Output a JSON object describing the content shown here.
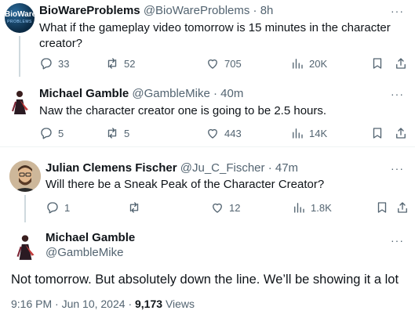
{
  "tweets": [
    {
      "name": "BioWareProblems",
      "handle": "@BioWareProblems",
      "sep": "·",
      "time": "8h",
      "text_lines": [
        "What if the gameplay video tomorrow is 15 minutes in the character",
        "creator?"
      ],
      "avatar_text": "BioWare PROBLEMS",
      "replies": "33",
      "reposts": "52",
      "likes": "705",
      "views": "20K"
    },
    {
      "name": "Michael Gamble",
      "handle": "@GambleMike",
      "sep": "·",
      "time": "40m",
      "text_lines": [
        "Naw the character creator one is going to be 2.5 hours."
      ],
      "replies": "5",
      "reposts": "5",
      "likes": "443",
      "views": "14K"
    },
    {
      "name": "Julian Clemens Fischer",
      "handle": "@Ju_C_Fischer",
      "sep": "·",
      "time": "47m",
      "text_lines": [
        "Will there be a Sneak Peak of the Character Creator?"
      ],
      "replies": "1",
      "reposts": "",
      "likes": "12",
      "views": "1.8K"
    }
  ],
  "main": {
    "name": "Michael Gamble",
    "handle": "@GambleMike",
    "text": "Not tomorrow. But absolutely down the line. We’ll be showing it a lot",
    "timestamp": "9:16 PM · Jun 10, 2024",
    "sep": "·",
    "views_count": "9,173",
    "views_label": "Views"
  },
  "more_glyph": "···",
  "icons": [
    "reply-icon",
    "repost-icon",
    "like-icon",
    "views-icon",
    "bookmark-icon",
    "share-icon",
    "more-icon"
  ],
  "colors": {
    "text": "#0f1419",
    "secondary": "#536471",
    "thread_line": "#cfd9de",
    "divider": "#eff3f4"
  }
}
